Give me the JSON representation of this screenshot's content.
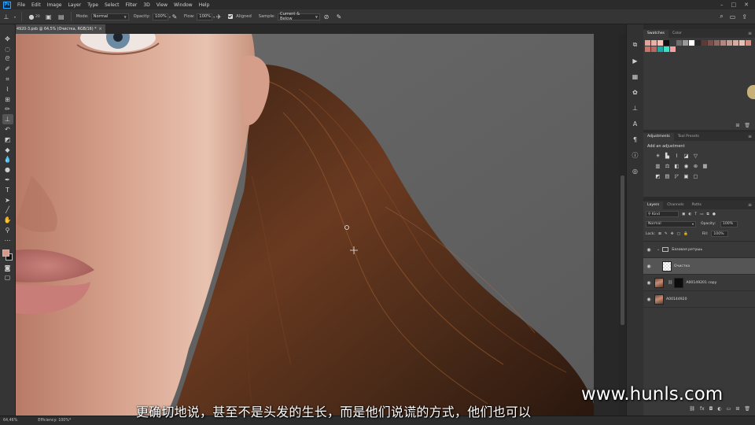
{
  "app": {
    "logo": "Ps"
  },
  "menu": [
    "File",
    "Edit",
    "Image",
    "Layer",
    "Type",
    "Select",
    "Filter",
    "3D",
    "View",
    "Window",
    "Help"
  ],
  "options_bar": {
    "brush_size": "20",
    "mode_label": "Mode:",
    "mode_value": "Normal",
    "opacity_label": "Opacity:",
    "opacity_value": "100%",
    "flow_label": "Flow:",
    "flow_value": "100%",
    "aligned_label": "Aligned",
    "aligned_checked": true,
    "sample_label": "Sample:",
    "sample_value": "Current & Below"
  },
  "document": {
    "tab_title": "4920-3.psb @ 64,5% (Очистка, RGB/16) *",
    "zoom": "64,46%",
    "status": "Efficiency: 100%*"
  },
  "swatches_panel": {
    "tabs": [
      "Swatches",
      "Color"
    ],
    "colors": [
      "#e3a39a",
      "#e8b0a7",
      "#f4c1b7",
      "#111111",
      "#3b3b3b",
      "#6e6e6e",
      "#9a9a9a",
      "#ffffff",
      "#2a2a2a",
      "#5a3b36",
      "#7a4f49",
      "#8b6a65",
      "#b4867f",
      "#c29b92",
      "#d6aca2",
      "#e6c3b9",
      "#d98c82",
      "#c7766d",
      "#b56b63",
      "#1fa7a3",
      "#3be0c2",
      "#f3a0a6"
    ]
  },
  "adjustments_panel": {
    "tabs": [
      "Adjustments",
      "Tool Presets"
    ],
    "title": "Add an adjustment"
  },
  "layers_panel": {
    "tabs": [
      "Layers",
      "Channels",
      "Paths"
    ],
    "filter_kind": "Kind",
    "blend_mode": "Normal",
    "opacity_label": "Opacity:",
    "opacity_value": "100%",
    "lock_label": "Lock:",
    "fill_label": "Fill:",
    "fill_value": "100%",
    "layers": [
      {
        "name": "Базовая ретушь",
        "type": "group"
      },
      {
        "name": "Очистка",
        "type": "pixel",
        "selected": true
      },
      {
        "name": "A00149201 copy",
        "type": "masked"
      },
      {
        "name": "A00144920",
        "type": "pixel"
      }
    ]
  },
  "overlays": {
    "subtitle": "更确切地说，甚至不是头发的生长，而是他们说谎的方式，他们也可以",
    "watermark": "www.hunls.com"
  }
}
